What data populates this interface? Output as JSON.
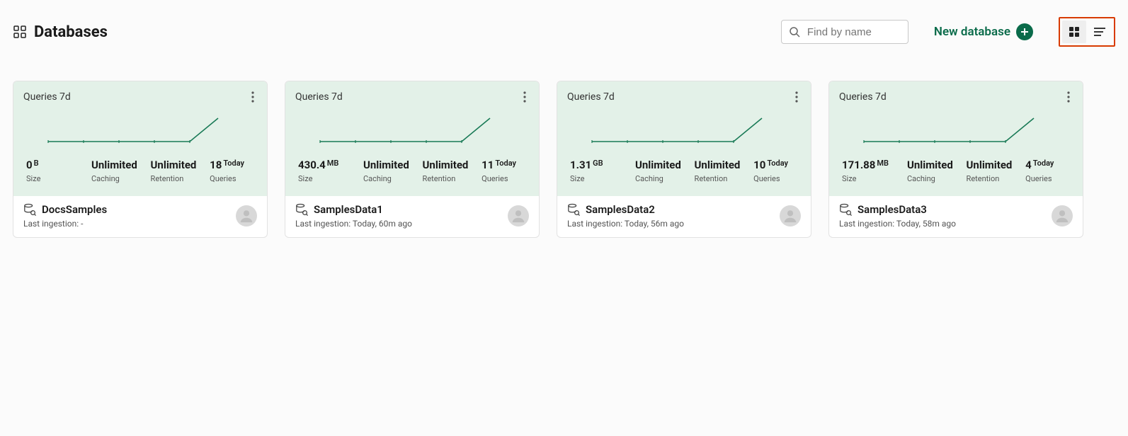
{
  "header": {
    "title": "Databases",
    "search_placeholder": "Find by name",
    "new_database_label": "New database"
  },
  "chart_label": "Queries 7d",
  "stats_labels": {
    "size": "Size",
    "caching": "Caching",
    "retention": "Retention",
    "queries": "Queries",
    "today_unit": "Today"
  },
  "chart_data": [
    {
      "type": "line",
      "title": "Queries 7d",
      "xlabel": "",
      "ylabel": "",
      "x": [
        1,
        2,
        3,
        4,
        5,
        6,
        7
      ],
      "y": [
        0,
        0,
        0,
        0,
        0,
        0,
        18
      ]
    },
    {
      "type": "line",
      "title": "Queries 7d",
      "xlabel": "",
      "ylabel": "",
      "x": [
        1,
        2,
        3,
        4,
        5,
        6,
        7
      ],
      "y": [
        0,
        0,
        0,
        0,
        0,
        0,
        11
      ]
    },
    {
      "type": "line",
      "title": "Queries 7d",
      "xlabel": "",
      "ylabel": "",
      "x": [
        1,
        2,
        3,
        4,
        5,
        6,
        7
      ],
      "y": [
        0,
        0,
        0,
        0,
        0,
        0,
        10
      ]
    },
    {
      "type": "line",
      "title": "Queries 7d",
      "xlabel": "",
      "ylabel": "",
      "x": [
        1,
        2,
        3,
        4,
        5,
        6,
        7
      ],
      "y": [
        0,
        0,
        0,
        0,
        0,
        0,
        4
      ]
    }
  ],
  "cards": [
    {
      "name": "DocsSamples",
      "size_val": "0",
      "size_unit": "B",
      "caching": "Unlimited",
      "retention": "Unlimited",
      "queries_val": "18",
      "ingestion": "Last ingestion: -"
    },
    {
      "name": "SamplesData1",
      "size_val": "430.4",
      "size_unit": "MB",
      "caching": "Unlimited",
      "retention": "Unlimited",
      "queries_val": "11",
      "ingestion": "Last ingestion: Today, 60m ago"
    },
    {
      "name": "SamplesData2",
      "size_val": "1.31",
      "size_unit": "GB",
      "caching": "Unlimited",
      "retention": "Unlimited",
      "queries_val": "10",
      "ingestion": "Last ingestion: Today, 56m ago"
    },
    {
      "name": "SamplesData3",
      "size_val": "171.88",
      "size_unit": "MB",
      "caching": "Unlimited",
      "retention": "Unlimited",
      "queries_val": "4",
      "ingestion": "Last ingestion: Today, 58m ago"
    }
  ]
}
